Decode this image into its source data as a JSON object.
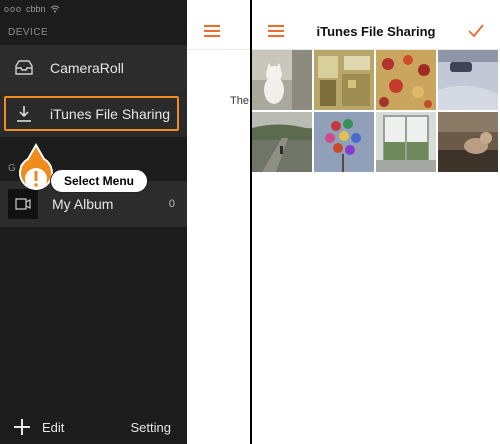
{
  "status_bar": {
    "carrier": "ooo",
    "carrier_label": "cbbn"
  },
  "sidemenu": {
    "section_device": "DEVICE",
    "section_albums": "G        MS",
    "items": [
      {
        "label": "CameraRoll"
      },
      {
        "label": "iTunes File Sharing"
      }
    ],
    "albums": [
      {
        "label": "My Album",
        "count": "0"
      }
    ],
    "bottom": {
      "edit_label": "Edit",
      "setting_label": "Setting"
    }
  },
  "callout": {
    "text": "Select Menu",
    "accent": "#f08b1d"
  },
  "middle": {
    "text": "The"
  },
  "right": {
    "title": "iTunes File Sharing",
    "accent": "#ef6a2c",
    "photos": [
      "cat-on-floor",
      "kitchen",
      "lanterns",
      "car-snow",
      "river-bridge",
      "lanterns-2",
      "window-garden",
      "cat-on-bench"
    ]
  }
}
